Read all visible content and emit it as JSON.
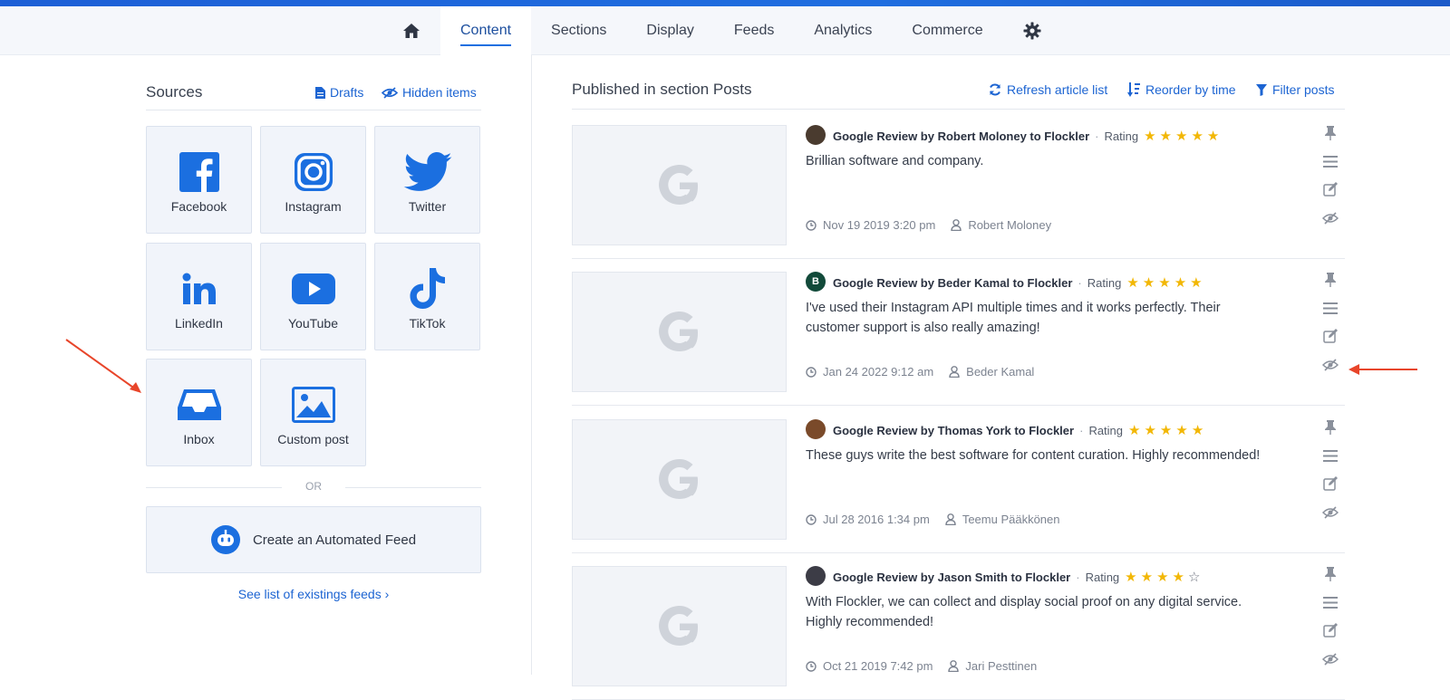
{
  "nav": {
    "items": [
      "Content",
      "Sections",
      "Display",
      "Feeds",
      "Analytics",
      "Commerce"
    ],
    "active": "Content"
  },
  "sources": {
    "title": "Sources",
    "drafts_label": "Drafts",
    "hidden_label": "Hidden items",
    "tiles": [
      {
        "label": "Facebook",
        "icon": "facebook-icon"
      },
      {
        "label": "Instagram",
        "icon": "instagram-icon"
      },
      {
        "label": "Twitter",
        "icon": "twitter-icon"
      },
      {
        "label": "LinkedIn",
        "icon": "linkedin-icon"
      },
      {
        "label": "YouTube",
        "icon": "youtube-icon"
      },
      {
        "label": "TikTok",
        "icon": "tiktok-icon"
      },
      {
        "label": "Inbox",
        "icon": "inbox-icon"
      },
      {
        "label": "Custom post",
        "icon": "image-icon"
      }
    ],
    "or_label": "OR",
    "automated_feed_label": "Create an Automated Feed",
    "see_list_label": "See list of existings feeds ›"
  },
  "published": {
    "title": "Published in section Posts",
    "refresh_label": "Refresh article list",
    "reorder_label": "Reorder by time",
    "filter_label": "Filter posts",
    "posts": [
      {
        "title": "Google Review by Robert Moloney to Flockler",
        "rating_label": "Rating",
        "rating": 5,
        "text": "Brillian software and company.",
        "date": "Nov 19 2019 3:20 pm",
        "author": "Robert Moloney",
        "avatar_text": ""
      },
      {
        "title": "Google Review by Beder Kamal to Flockler",
        "rating_label": "Rating",
        "rating": 5,
        "text": "I've used their Instagram API multiple times and it works perfectly. Their customer support is also really amazing!",
        "date": "Jan 24 2022 9:12 am",
        "author": "Beder Kamal",
        "avatar_text": "B"
      },
      {
        "title": "Google Review by Thomas York to Flockler",
        "rating_label": "Rating",
        "rating": 5,
        "text": "These guys write the best software for content curation. Highly recommended!",
        "date": "Jul 28 2016 1:34 pm",
        "author": "Teemu Pääkkönen",
        "avatar_text": ""
      },
      {
        "title": "Google Review by Jason Smith to Flockler",
        "rating_label": "Rating",
        "rating": 4,
        "text": "With Flockler, we can collect and display social proof on any digital service. Highly recommended!",
        "date": "Oct 21 2019 7:42 pm",
        "author": "Jari Pesttinen",
        "avatar_text": ""
      }
    ]
  },
  "colors": {
    "accent": "#1b6fe0",
    "star": "#f2b705",
    "annotation_arrow": "#e8452a"
  }
}
